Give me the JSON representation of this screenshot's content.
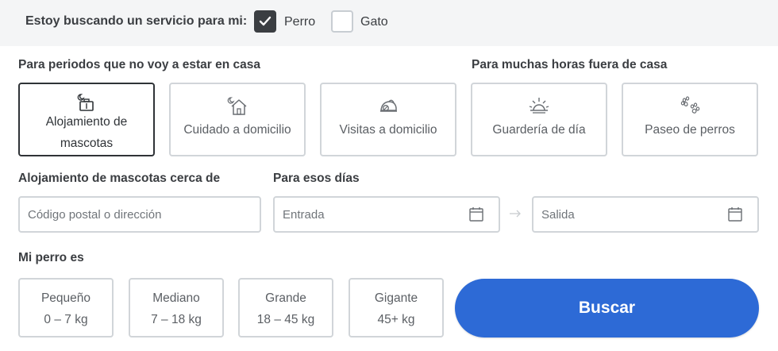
{
  "header": {
    "prompt": "Estoy buscando un servicio para mi:",
    "pets": [
      {
        "label": "Perro",
        "checked": true
      },
      {
        "label": "Gato",
        "checked": false
      }
    ]
  },
  "services": {
    "away_title": "Para periodos que no voy a estar en casa",
    "hours_title": "Para muchas horas fuera de casa",
    "items": [
      {
        "label_line1": "Alojamiento de",
        "label_line2": "mascotas",
        "icon": "boarding-icon",
        "selected": true
      },
      {
        "label": "Cuidado a domicilio",
        "icon": "house-sitting-icon",
        "selected": false
      },
      {
        "label": "Visitas a domicilio",
        "icon": "drop-in-icon",
        "selected": false
      },
      {
        "label": "Guardería de día",
        "icon": "sunrise-icon",
        "selected": false
      },
      {
        "label": "Paseo de perros",
        "icon": "paw-icon",
        "selected": false
      }
    ]
  },
  "location": {
    "label": "Alojamiento de mascotas cerca de",
    "placeholder": "Código postal o dirección"
  },
  "dates": {
    "label": "Para esos días",
    "start_placeholder": "Entrada",
    "end_placeholder": "Salida"
  },
  "dog_size": {
    "label": "Mi perro es",
    "options": [
      {
        "name": "Pequeño",
        "range": "0 – 7 kg"
      },
      {
        "name": "Mediano",
        "range": "7 – 18 kg"
      },
      {
        "name": "Grande",
        "range": "18 – 45 kg"
      },
      {
        "name": "Gigante",
        "range": "45+ kg"
      }
    ]
  },
  "search": {
    "label": "Buscar"
  },
  "colors": {
    "accent": "#2d6ad6",
    "text": "#3b3e42",
    "border": "#d1d5d9",
    "topbar_bg": "#f4f5f6"
  }
}
